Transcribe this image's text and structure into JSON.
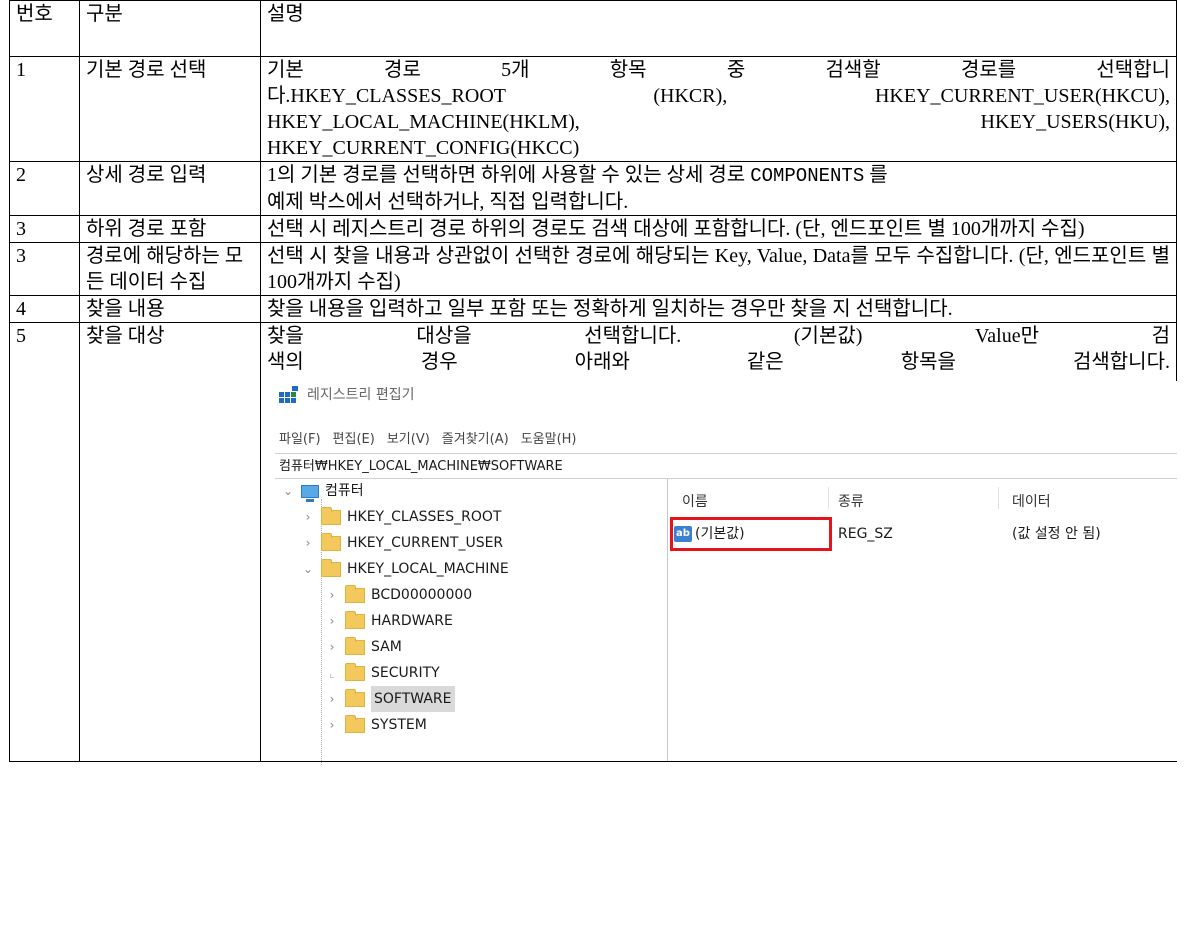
{
  "table": {
    "headers": [
      "번호",
      "구분",
      "설명"
    ],
    "rows": [
      {
        "num": "1",
        "category": "기본 경로 선택",
        "desc_lines": [
          "기본 경로 5개 항목 중 검색할 경로를 선택합니",
          "다.HKEY_CLASSES_ROOT (HKCR), HKEY_CURRENT_USER(HKCU),",
          "HKEY_LOCAL_MACHINE(HKLM), HKEY_USERS(HKU),",
          "HKEY_CURRENT_CONFIG(HKCC)"
        ]
      },
      {
        "num": "2",
        "category": "상세 경로 입력",
        "desc_prefix": "1의 기본 경로를 선택하면 하위에 사용할 수 있는 상세 경로 ",
        "desc_code": "COMPONENTS",
        "desc_suffix": " 를",
        "desc_line2": "예제 박스에서 선택하거나, 직접 입력합니다."
      },
      {
        "num": "3",
        "category": "하위 경로 포함",
        "desc": "선택 시 레지스트리 경로 하위의 경로도 검색 대상에 포함합니다. (단, 엔드포인트 별 100개까지 수집)"
      },
      {
        "num": "3",
        "category": "경로에 해당하는 모든 데이터 수집",
        "desc": "선택 시 찾을 내용과 상관없이 선택한 경로에 해당되는 Key, Value, Data를 모두 수집합니다. (단, 엔드포인트 별 100개까지 수집)"
      },
      {
        "num": "4",
        "category": "찾을 내용",
        "desc": "찾을 내용을 입력하고 일부 포함 또는 정확하게 일치하는 경우만 찾을 지 선택합니다."
      },
      {
        "num": "5",
        "category": "찾을 대상",
        "desc_lines": [
          "찾을 대상을 선택합니다. (기본값) Value만 검",
          "색의 경우 아래와 같은 항목을 검색합니다."
        ]
      }
    ]
  },
  "regedit": {
    "title": "레지스트리 편집기",
    "menu": [
      "파일(F)",
      "편집(E)",
      "보기(V)",
      "즐겨찾기(A)",
      "도움말(H)"
    ],
    "address": "컴퓨터₩HKEY_LOCAL_MACHINE₩SOFTWARE",
    "tree": {
      "root": "컴퓨터",
      "hives": [
        "HKEY_CLASSES_ROOT",
        "HKEY_CURRENT_USER",
        "HKEY_LOCAL_MACHINE"
      ],
      "subkeys": [
        "BCD00000000",
        "HARDWARE",
        "SAM",
        "SECURITY",
        "SOFTWARE",
        "SYSTEM"
      ],
      "selected": "SOFTWARE"
    },
    "columns": [
      "이름",
      "종류",
      "데이터"
    ],
    "value_row": {
      "name": "(기본값)",
      "type": "REG_SZ",
      "data": "(값 설정 안 됨)",
      "icon_text": "ab"
    },
    "highlight_color": "#e3141c"
  }
}
